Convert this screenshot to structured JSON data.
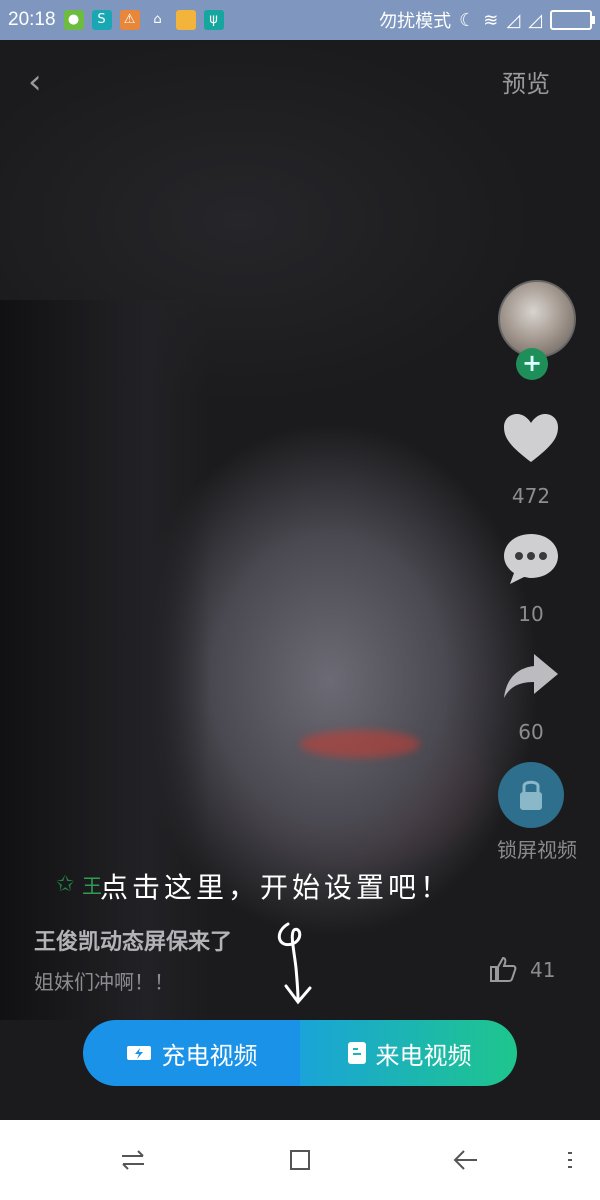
{
  "status_bar": {
    "time": "20:18",
    "mode": "勿扰模式"
  },
  "header": {
    "preview_label": "预览"
  },
  "actions": {
    "like_count": "472",
    "comment_count": "10",
    "share_count": "60",
    "lock_label": "锁屏视频"
  },
  "overlay": {
    "tip": "点击这里，开始设置吧！",
    "author": "王"
  },
  "video": {
    "title": "王俊凯动态屏保来了",
    "description": "姐妹们冲啊！！",
    "bottom_like_count": "41"
  },
  "buttons": {
    "charge_label": "充电视频",
    "call_label": "来电视频"
  },
  "colors": {
    "status_bar": "#7f97bf",
    "charge_button": "#1a92e8",
    "call_button_start": "#1aa4d8",
    "call_button_end": "#1ec68c",
    "follow_green": "#1f8f5a"
  }
}
